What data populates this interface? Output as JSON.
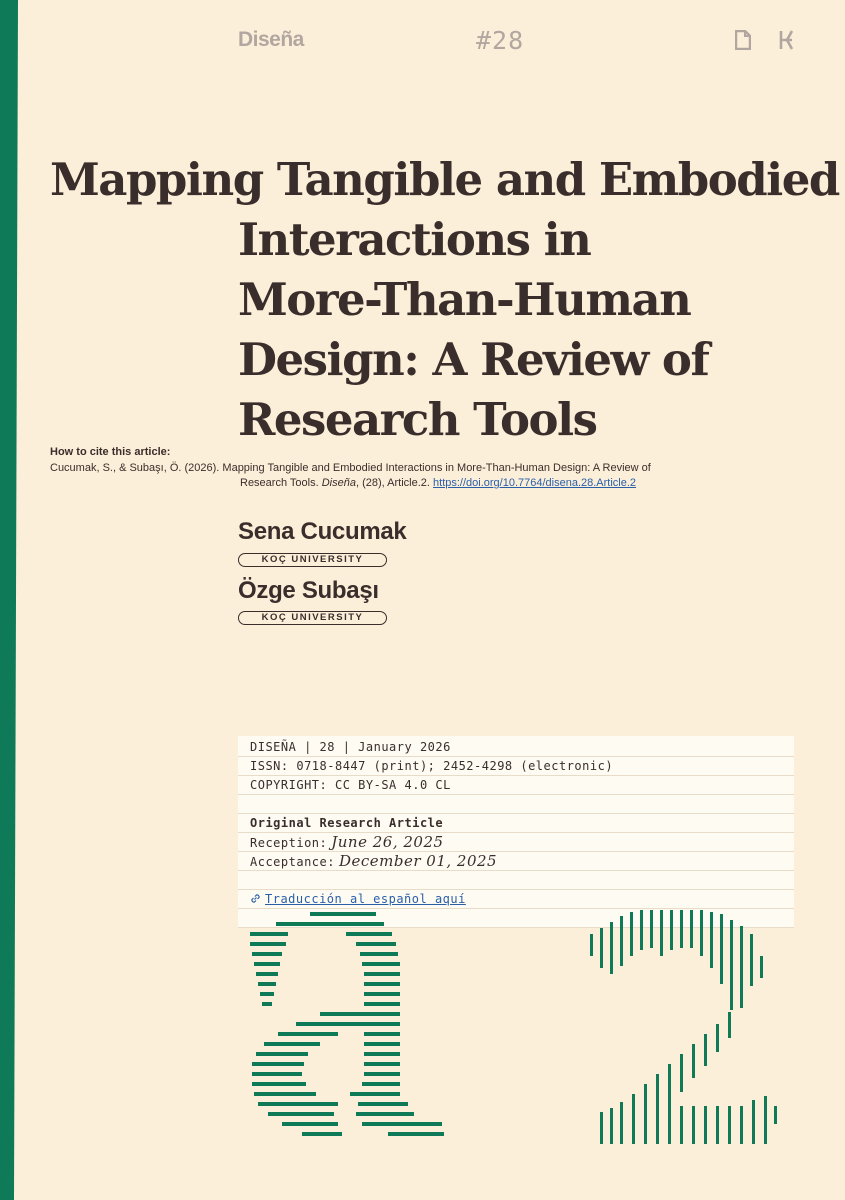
{
  "header": {
    "brand": "Diseña",
    "issue": "#28"
  },
  "title": {
    "line1": "Mapping Tangible and Embodied",
    "line2": "Interactions in",
    "line3": "More-Than-Human",
    "line4": "Design: A Review of",
    "line5": "Research Tools"
  },
  "citation": {
    "label": "How to cite this article:",
    "line1": "Cucumak, S., & Subaşı, Ö. (2026). Mapping Tangible and Embodied Interactions in More-Than-Human Design: A Review of",
    "line2_pre": "Research Tools. ",
    "journal": "Diseña",
    "line2_post": ", (28), Article.2. ",
    "doi": "https://doi.org/10.7764/disena.28.Article.2"
  },
  "authors": [
    {
      "name": "Sena Cucumak",
      "affiliation": "KOÇ UNIVERSITY"
    },
    {
      "name": "Özge Subaşı",
      "affiliation": "KOÇ UNIVERSITY"
    }
  ],
  "info": {
    "line1": "DISEÑA | 28 | January 2026",
    "line2": "ISSN: 0718-8447 (print); 2452-4298 (electronic)",
    "line3": "COPYRIGHT: CC BY-SA 4.0 CL",
    "article_type": "Original Research Article",
    "reception_label": "Reception:",
    "reception_date": "June 26, 2025",
    "acceptance_label": "Acceptance:",
    "acceptance_date": "December 01, 2025",
    "translation_link": "Traducción al español aquí"
  },
  "colors": {
    "background": "#fcefd9",
    "accent_green": "#0e7a57",
    "text": "#3a2e2c",
    "link": "#2a5fa8",
    "muted": "#b2a7a0"
  },
  "icons": [
    "document-icon",
    "hyphenation-icon",
    "link-icon"
  ]
}
